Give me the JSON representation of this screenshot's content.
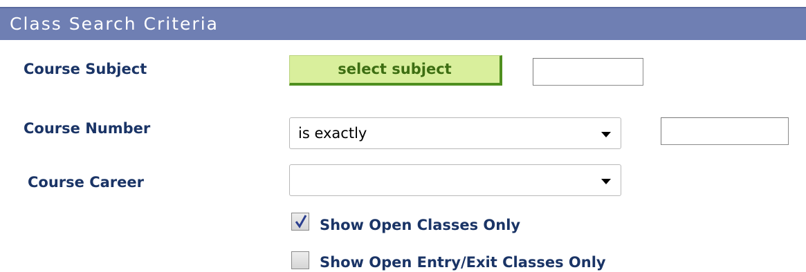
{
  "header": {
    "title": "Class Search Criteria"
  },
  "course_subject": {
    "label": "Course Subject",
    "button_label": "select subject",
    "value": ""
  },
  "course_number": {
    "label": "Course Number",
    "operator": "is exactly",
    "value": ""
  },
  "course_career": {
    "label": "Course Career",
    "value": ""
  },
  "options": {
    "open_only": {
      "label": "Show Open Classes Only",
      "checked": true
    },
    "open_entry_exit": {
      "label": "Show Open Entry/Exit Classes Only",
      "checked": false
    }
  },
  "colors": {
    "header": "#6f7fb3",
    "label": "#1a3466",
    "button_bg": "#d9ef9c",
    "button_border": "#4f8f1f"
  }
}
